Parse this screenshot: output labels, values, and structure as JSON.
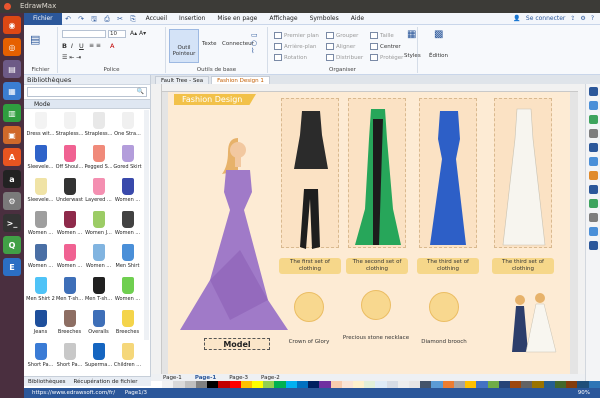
{
  "window": {
    "title": "EdrawMax"
  },
  "quick_access": [
    "↶",
    "↷",
    "🖫",
    "⎙",
    "✂",
    "⎘"
  ],
  "ribbon": {
    "tabs": [
      "Fichier",
      "Accueil",
      "Insertion",
      "Mise en page",
      "Affichage",
      "Symboles",
      "Aide"
    ],
    "connect_label": "Se connecter",
    "groups": {
      "fichier": "Fichier",
      "police": "Police",
      "outils": "Outils de base",
      "organiser": "Organiser"
    },
    "font_size": "10",
    "outil_pointeur": "Outil Pointeur",
    "texte": "Texte",
    "connecteur": "Connecteur",
    "premier_plan": "Premier plan",
    "arriere_plan": "Arrière-plan",
    "rotation": "Rotation",
    "grouper": "Grouper",
    "aligner": "Aligner",
    "distribuer": "Distribuer",
    "taille": "Taille",
    "centrer": "Centrer",
    "proteger": "Protéger",
    "styles": "Styles",
    "edition": "Édition"
  },
  "library": {
    "title": "Bibliothèques",
    "search_placeholder": "",
    "category": "Mode",
    "items": [
      {
        "label": "Dress wit...",
        "color": "#f3f3f3"
      },
      {
        "label": "Strapless...",
        "color": "#f2f2f2"
      },
      {
        "label": "Strapless...",
        "color": "#e8e8e8"
      },
      {
        "label": "One Stra...",
        "color": "#f0f0f0"
      },
      {
        "label": "Sleevele...",
        "color": "#2f63c9"
      },
      {
        "label": "Off Shoul...",
        "color": "#f06292"
      },
      {
        "label": "Pegged S...",
        "color": "#f08a7a"
      },
      {
        "label": "Gored Skirt",
        "color": "#b39ddb"
      },
      {
        "label": "Sleevele...",
        "color": "#f0e3a6"
      },
      {
        "label": "Underwast",
        "color": "#333333"
      },
      {
        "label": "Layered ...",
        "color": "#f48fb1"
      },
      {
        "label": "Women ...",
        "color": "#3949ab"
      },
      {
        "label": "Women ...",
        "color": "#9e9e9e"
      },
      {
        "label": "Women ...",
        "color": "#8e2a4a"
      },
      {
        "label": "Women J...",
        "color": "#9ccc65"
      },
      {
        "label": "Women ...",
        "color": "#424242"
      },
      {
        "label": "Women ...",
        "color": "#4a6fa5"
      },
      {
        "label": "Women ...",
        "color": "#f06292"
      },
      {
        "label": "Women ...",
        "color": "#81b4e0"
      },
      {
        "label": "Men Shirt",
        "color": "#4a8fd8"
      },
      {
        "label": "Men Shirt 2",
        "color": "#4fc3f7"
      },
      {
        "label": "Men T-sh...",
        "color": "#3e6fb8"
      },
      {
        "label": "Men T-sh...",
        "color": "#212121"
      },
      {
        "label": "Women ...",
        "color": "#6fcf50"
      },
      {
        "label": "Jeans",
        "color": "#1e4f9c"
      },
      {
        "label": "Breeches",
        "color": "#8d6e63"
      },
      {
        "label": "Overalls",
        "color": "#3e6fb8"
      },
      {
        "label": "Breeches",
        "color": "#f4d44a"
      },
      {
        "label": "Short Pa...",
        "color": "#3a7bd5"
      },
      {
        "label": "Short Pa...",
        "color": "#c8c8c8"
      },
      {
        "label": "Superma...",
        "color": "#1565c0"
      },
      {
        "label": "Children ...",
        "color": "#f5d77a"
      }
    ],
    "bottom_tabs": [
      "Bibliothèques",
      "Récupération de fichier"
    ]
  },
  "doc_tabs": [
    {
      "label": "Fault Tree - Sea"
    },
    {
      "label": "Fashion Design 1"
    }
  ],
  "canvas": {
    "banner": "Fashion Design",
    "cards": [
      {
        "caption": "The first set of clothing",
        "color": "#2b2b2b"
      },
      {
        "caption": "The second set of clothing",
        "color": "#27a65a"
      },
      {
        "caption": "The third set of clothing",
        "color": "#2d5fc7"
      },
      {
        "caption": "The third set of clothing",
        "color": "#f7f5ef"
      }
    ],
    "accessories": [
      {
        "caption": "Crown of Glory"
      },
      {
        "caption": "Precious stone necklace"
      },
      {
        "caption": "Diamond brooch"
      }
    ],
    "model_label": "Model"
  },
  "page_tabs": [
    "Page-1",
    "Page-1",
    "Page-3",
    "Page-2"
  ],
  "palette": [
    "#ffffff",
    "#f2f2f2",
    "#d9d9d9",
    "#bfbfbf",
    "#808080",
    "#000000",
    "#c00000",
    "#ff0000",
    "#ffc000",
    "#ffff00",
    "#92d050",
    "#00b050",
    "#00b0f0",
    "#0070c0",
    "#002060",
    "#7030a0",
    "#f8cbad",
    "#fbe5d6",
    "#fff2cc",
    "#e2f0d9",
    "#deebf7",
    "#d6dce5",
    "#ededed",
    "#e7e6e6",
    "#44546a",
    "#5b9bd5",
    "#ed7d31",
    "#a5a5a5",
    "#ffc000",
    "#4472c4",
    "#70ad47",
    "#264478",
    "#9e480e",
    "#636363",
    "#997300",
    "#255e91",
    "#43682b",
    "#843c0c",
    "#1f4e79",
    "#2e75b6"
  ],
  "status": {
    "url": "https://www.edrawsoft.com/fr/",
    "page": "Page1/3",
    "zoom": "90%"
  }
}
